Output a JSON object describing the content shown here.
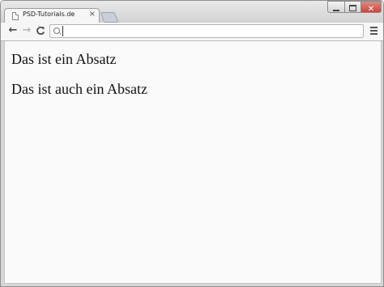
{
  "tab": {
    "title": "PSD-Tutorials.de",
    "close_label": "×",
    "page_icon": "page-icon"
  },
  "toolbar": {
    "back_label": "←",
    "forward_label": "→",
    "reload_label": "C",
    "menu_icon": "hamburger-menu-icon"
  },
  "omnibox": {
    "value": "",
    "placeholder": ""
  },
  "window_controls": {
    "close_label": "✕"
  },
  "content": {
    "paragraphs": [
      "Das ist ein Absatz",
      "Das ist auch ein Absatz"
    ]
  }
}
